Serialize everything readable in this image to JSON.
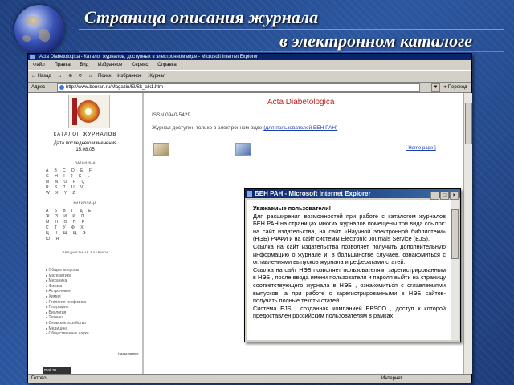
{
  "slide": {
    "title_line1": "Страница описания журнала",
    "title_line2": "в электронном каталоге"
  },
  "browser": {
    "window_title": "Acta Diabetologica - Каталог журналов, доступных в электронном виде - Microsoft Internet Explorer",
    "menu": [
      "Файл",
      "Правка",
      "Вид",
      "Избранное",
      "Сервис",
      "Справка"
    ],
    "toolbar": [
      "← Назад",
      "→",
      "⊗",
      "⟳",
      "⌂",
      "Поиск",
      "Избранное",
      "Журнал"
    ],
    "address_label": "Адрес",
    "address_value": "http://www.benran.ru/Magazin/El/Sk_alk1.htm",
    "go_label": "Переход",
    "status_text": "Готово",
    "zone_text": "Интернет"
  },
  "catalog": {
    "heading": "КАТАЛОГ ЖУРНАЛОВ",
    "last_change_label": "Дата последнего изменения",
    "last_change_date": "15.08.05",
    "latin_label": "ЛАТИНИЦА",
    "latin_letters": "A B C D E F G H I J K L M N O P Q R S T U V W X Y Z",
    "cyrillic_label": "КИРИЛЛИЦА",
    "cyrillic_letters": "А Б В Г Д Е Ж З И К Л М Н О П Р С Т У Ф Х Ц Ч Ш Щ Э Ю Я",
    "subjects_label": "ПРЕДМЕТНЫЕ РУБРИКИ",
    "subjects": [
      "Общие вопросы",
      "Математика",
      "Механика",
      "Физика",
      "Астрономия",
      "Химия",
      "Геология геофизика",
      "География",
      "Биология",
      "Техника",
      "Сельское хозяйство",
      "Медицина",
      "Общественные науки"
    ],
    "more_label": "Назад наверх"
  },
  "journal": {
    "title": "Acta Diabetologica",
    "issn": "ISSN 0940-5429",
    "access_text": "Журнал доступен только в электронном виде",
    "access_link": "(для пользователей БЕН РАН)",
    "home_link": "[ Home page ]"
  },
  "popup": {
    "title": "БЕН РАН - Microsoft Internet Explorer",
    "heading": "Уважаемые пользователи!",
    "paragraphs": [
      "Для расширения возможностей при работе с каталогом журналов БЕН РАН на страницах многих журналов помещены три вида ссылок: на сайт издательства, на сайт «Научной электронной библиотеки» (НЭБ) РФФИ и на сайт системы Electronic Journals Service (EJS).",
      "Ссылка на сайт издательства позволяет получить дополнительную информацию о журнале и, в большинстве случаев, ознакомиться с оглавлениями выпусков журнала и рефератами статей.",
      "Ссылка на сайт НЭБ позволяет пользователям, зарегистрированным в НЭБ , после ввода имени пользователя и пароля выйти на страницу соответствующего журнала в НЭБ , ознакомиться с оглавлениями выпусков, а при работе с зарегистрированными в НЭБ сайтов- получать полные тексты статей.",
      "Система EJS , созданная компанией EBSCO , доступ к которой предоставлен российским пользователям в рамках"
    ]
  }
}
